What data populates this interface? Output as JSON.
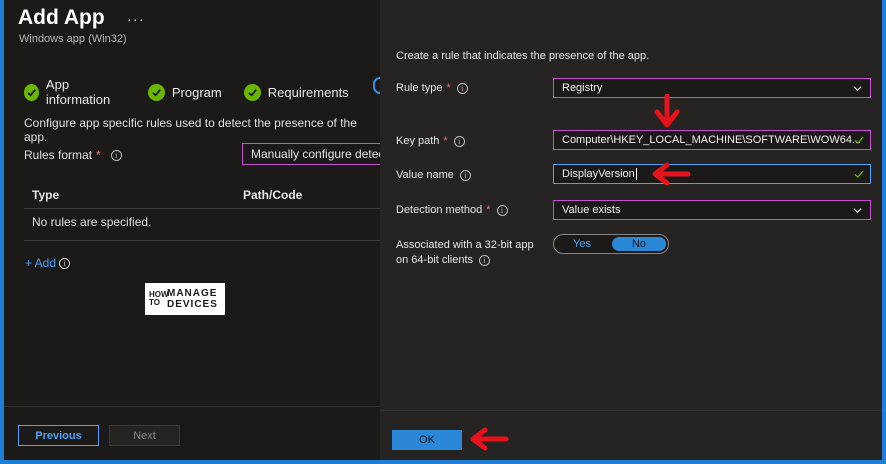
{
  "header": {
    "title": "Add App",
    "more": "···",
    "subtitle": "Windows app (Win32)"
  },
  "steps": [
    {
      "label": "App information"
    },
    {
      "label": "Program"
    },
    {
      "label": "Requirements"
    }
  ],
  "left": {
    "description": "Configure app specific rules used to detect the presence of the app.",
    "rules_format_label": "Rules format",
    "rules_format_value": "Manually configure detection rules",
    "table": {
      "col_type": "Type",
      "col_path": "Path/Code",
      "empty": "No rules are specified."
    },
    "add_link": "+ Add",
    "logo": {
      "how": "HOW TO",
      "line1": "MANAGE",
      "line2": "DEVICES"
    }
  },
  "footer": {
    "previous": "Previous",
    "next": "Next"
  },
  "panel": {
    "intro": "Create a rule that indicates the presence of the app.",
    "rule_type_label": "Rule type",
    "rule_type_value": "Registry",
    "key_path_label": "Key path",
    "key_path_value": "Computer\\HKEY_LOCAL_MACHINE\\SOFTWARE\\WOW64...",
    "value_name_label": "Value name",
    "value_name_value": "DisplayVersion",
    "detection_label": "Detection method",
    "detection_value": "Value exists",
    "assoc_label_1": "Associated with a 32-bit app",
    "assoc_label_2": "on 64-bit clients",
    "toggle_yes": "Yes",
    "toggle_no": "No",
    "ok": "OK"
  },
  "colors": {
    "accent": "#2b88d8",
    "required": "#f1707b",
    "success": "#6bb700",
    "highlight": "#c74fd3",
    "annotation": "#e8121b"
  }
}
